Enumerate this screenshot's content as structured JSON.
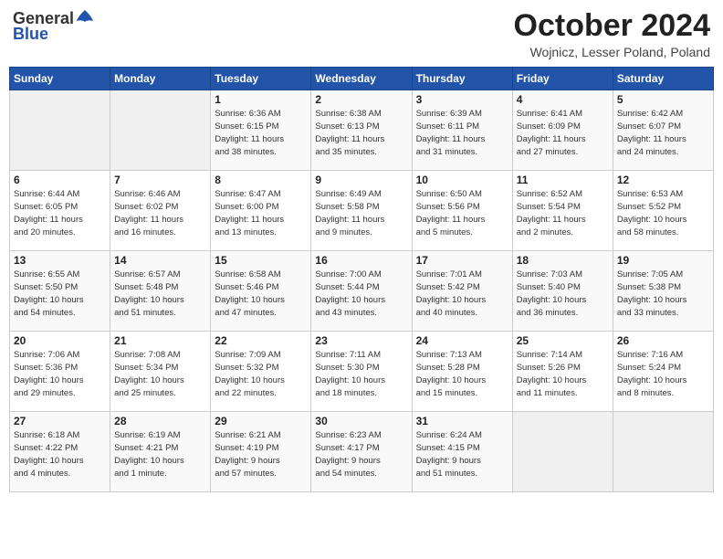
{
  "header": {
    "logo_general": "General",
    "logo_blue": "Blue",
    "month_title": "October 2024",
    "location": "Wojnicz, Lesser Poland, Poland"
  },
  "days_of_week": [
    "Sunday",
    "Monday",
    "Tuesday",
    "Wednesday",
    "Thursday",
    "Friday",
    "Saturday"
  ],
  "weeks": [
    [
      {
        "day": "",
        "info": ""
      },
      {
        "day": "",
        "info": ""
      },
      {
        "day": "1",
        "info": "Sunrise: 6:36 AM\nSunset: 6:15 PM\nDaylight: 11 hours\nand 38 minutes."
      },
      {
        "day": "2",
        "info": "Sunrise: 6:38 AM\nSunset: 6:13 PM\nDaylight: 11 hours\nand 35 minutes."
      },
      {
        "day": "3",
        "info": "Sunrise: 6:39 AM\nSunset: 6:11 PM\nDaylight: 11 hours\nand 31 minutes."
      },
      {
        "day": "4",
        "info": "Sunrise: 6:41 AM\nSunset: 6:09 PM\nDaylight: 11 hours\nand 27 minutes."
      },
      {
        "day": "5",
        "info": "Sunrise: 6:42 AM\nSunset: 6:07 PM\nDaylight: 11 hours\nand 24 minutes."
      }
    ],
    [
      {
        "day": "6",
        "info": "Sunrise: 6:44 AM\nSunset: 6:05 PM\nDaylight: 11 hours\nand 20 minutes."
      },
      {
        "day": "7",
        "info": "Sunrise: 6:46 AM\nSunset: 6:02 PM\nDaylight: 11 hours\nand 16 minutes."
      },
      {
        "day": "8",
        "info": "Sunrise: 6:47 AM\nSunset: 6:00 PM\nDaylight: 11 hours\nand 13 minutes."
      },
      {
        "day": "9",
        "info": "Sunrise: 6:49 AM\nSunset: 5:58 PM\nDaylight: 11 hours\nand 9 minutes."
      },
      {
        "day": "10",
        "info": "Sunrise: 6:50 AM\nSunset: 5:56 PM\nDaylight: 11 hours\nand 5 minutes."
      },
      {
        "day": "11",
        "info": "Sunrise: 6:52 AM\nSunset: 5:54 PM\nDaylight: 11 hours\nand 2 minutes."
      },
      {
        "day": "12",
        "info": "Sunrise: 6:53 AM\nSunset: 5:52 PM\nDaylight: 10 hours\nand 58 minutes."
      }
    ],
    [
      {
        "day": "13",
        "info": "Sunrise: 6:55 AM\nSunset: 5:50 PM\nDaylight: 10 hours\nand 54 minutes."
      },
      {
        "day": "14",
        "info": "Sunrise: 6:57 AM\nSunset: 5:48 PM\nDaylight: 10 hours\nand 51 minutes."
      },
      {
        "day": "15",
        "info": "Sunrise: 6:58 AM\nSunset: 5:46 PM\nDaylight: 10 hours\nand 47 minutes."
      },
      {
        "day": "16",
        "info": "Sunrise: 7:00 AM\nSunset: 5:44 PM\nDaylight: 10 hours\nand 43 minutes."
      },
      {
        "day": "17",
        "info": "Sunrise: 7:01 AM\nSunset: 5:42 PM\nDaylight: 10 hours\nand 40 minutes."
      },
      {
        "day": "18",
        "info": "Sunrise: 7:03 AM\nSunset: 5:40 PM\nDaylight: 10 hours\nand 36 minutes."
      },
      {
        "day": "19",
        "info": "Sunrise: 7:05 AM\nSunset: 5:38 PM\nDaylight: 10 hours\nand 33 minutes."
      }
    ],
    [
      {
        "day": "20",
        "info": "Sunrise: 7:06 AM\nSunset: 5:36 PM\nDaylight: 10 hours\nand 29 minutes."
      },
      {
        "day": "21",
        "info": "Sunrise: 7:08 AM\nSunset: 5:34 PM\nDaylight: 10 hours\nand 25 minutes."
      },
      {
        "day": "22",
        "info": "Sunrise: 7:09 AM\nSunset: 5:32 PM\nDaylight: 10 hours\nand 22 minutes."
      },
      {
        "day": "23",
        "info": "Sunrise: 7:11 AM\nSunset: 5:30 PM\nDaylight: 10 hours\nand 18 minutes."
      },
      {
        "day": "24",
        "info": "Sunrise: 7:13 AM\nSunset: 5:28 PM\nDaylight: 10 hours\nand 15 minutes."
      },
      {
        "day": "25",
        "info": "Sunrise: 7:14 AM\nSunset: 5:26 PM\nDaylight: 10 hours\nand 11 minutes."
      },
      {
        "day": "26",
        "info": "Sunrise: 7:16 AM\nSunset: 5:24 PM\nDaylight: 10 hours\nand 8 minutes."
      }
    ],
    [
      {
        "day": "27",
        "info": "Sunrise: 6:18 AM\nSunset: 4:22 PM\nDaylight: 10 hours\nand 4 minutes."
      },
      {
        "day": "28",
        "info": "Sunrise: 6:19 AM\nSunset: 4:21 PM\nDaylight: 10 hours\nand 1 minute."
      },
      {
        "day": "29",
        "info": "Sunrise: 6:21 AM\nSunset: 4:19 PM\nDaylight: 9 hours\nand 57 minutes."
      },
      {
        "day": "30",
        "info": "Sunrise: 6:23 AM\nSunset: 4:17 PM\nDaylight: 9 hours\nand 54 minutes."
      },
      {
        "day": "31",
        "info": "Sunrise: 6:24 AM\nSunset: 4:15 PM\nDaylight: 9 hours\nand 51 minutes."
      },
      {
        "day": "",
        "info": ""
      },
      {
        "day": "",
        "info": ""
      }
    ]
  ]
}
